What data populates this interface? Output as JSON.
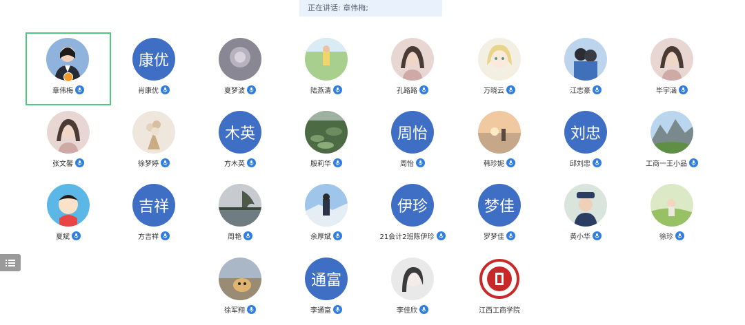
{
  "speaking": "正在讲话: 章伟梅;",
  "colors": {
    "active_border": "#4fc97e",
    "mic": "#2f7de1",
    "text_avatar": "#3f6fc4"
  },
  "participants": [
    {
      "name": "章伟梅",
      "avatar_type": "photo",
      "icon": "person-portrait-icon",
      "host": true,
      "active": true
    },
    {
      "name": "肖康优",
      "avatar_type": "text",
      "avatar_text": "康优"
    },
    {
      "name": "夏梦波",
      "avatar_type": "photo",
      "icon": "gray-photo-icon"
    },
    {
      "name": "陆燕清",
      "avatar_type": "photo",
      "icon": "outdoor-photo-icon"
    },
    {
      "name": "孔路路",
      "avatar_type": "photo",
      "icon": "girl-photo-icon"
    },
    {
      "name": "万晓云",
      "avatar_type": "photo",
      "icon": "anime-girl-icon"
    },
    {
      "name": "江志豪",
      "avatar_type": "photo",
      "icon": "couple-photo-icon"
    },
    {
      "name": "毕宇涵",
      "avatar_type": "photo",
      "icon": "girl-photo-icon"
    },
    {
      "name": "张文馨",
      "avatar_type": "photo",
      "icon": "girl-photo-icon"
    },
    {
      "name": "徐梦婷",
      "avatar_type": "photo",
      "icon": "flower-bouquet-icon"
    },
    {
      "name": "方木英",
      "avatar_type": "text",
      "avatar_text": "木英"
    },
    {
      "name": "殷莉华",
      "avatar_type": "photo",
      "icon": "lotus-pond-icon"
    },
    {
      "name": "周怡",
      "avatar_type": "text",
      "avatar_text": "周怡"
    },
    {
      "name": "韩珍妮",
      "avatar_type": "photo",
      "icon": "sunset-photo-icon"
    },
    {
      "name": "邱刘忠",
      "avatar_type": "text",
      "avatar_text": "刘忠"
    },
    {
      "name": "工商一王小品",
      "avatar_type": "photo",
      "icon": "mountain-landscape-icon"
    },
    {
      "name": "夏斌",
      "avatar_type": "photo",
      "icon": "cartoon-boy-icon"
    },
    {
      "name": "方吉祥",
      "avatar_type": "text",
      "avatar_text": "吉祥"
    },
    {
      "name": "周艳",
      "avatar_type": "photo",
      "icon": "lake-tree-icon"
    },
    {
      "name": "余厚斌",
      "avatar_type": "photo",
      "icon": "snow-hiker-icon"
    },
    {
      "name": "21会计2班陈伊珍",
      "avatar_type": "text",
      "avatar_text": "伊珍"
    },
    {
      "name": "罗梦佳",
      "avatar_type": "text",
      "avatar_text": "梦佳"
    },
    {
      "name": "黄小华",
      "avatar_type": "photo",
      "icon": "uniform-portrait-icon"
    },
    {
      "name": "徐珍",
      "avatar_type": "photo",
      "icon": "field-photo-icon"
    },
    {
      "name": "徐军翔",
      "avatar_type": "photo",
      "icon": "dog-photo-icon"
    },
    {
      "name": "李通富",
      "avatar_type": "text",
      "avatar_text": "通富"
    },
    {
      "name": "李佳欣",
      "avatar_type": "photo",
      "icon": "girl-sketch-icon"
    },
    {
      "name": "江西工商学院",
      "avatar_type": "photo",
      "icon": "college-logo-icon",
      "no_mic": true
    }
  ]
}
